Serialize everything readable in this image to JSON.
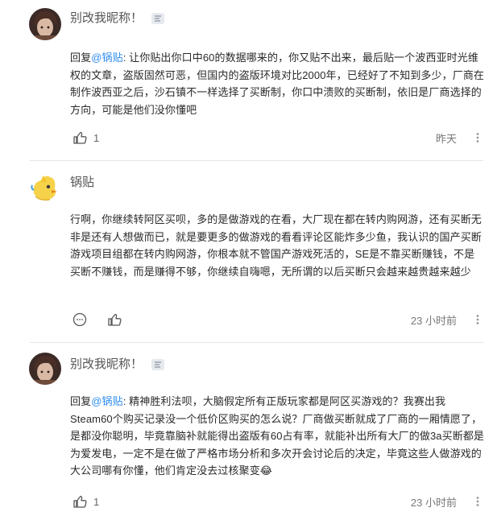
{
  "comments": [
    {
      "username": "别改我昵称！",
      "reply_prefix": "回复",
      "mention": "@锅贴",
      "text": ": 让你贴出你口中60的数据哪来的，你又贴不出来，最后贴一个波西亚时光维权的文章，盗版固然可恶，但国内的盗版环境对比2000年，已经好了不知到多少，厂商在制作波西亚之后，沙石镇不一样选择了买断制，你口中溃败的买断制，依旧是厂商选择的方向，可能是他们没你懂吧",
      "likes": "1",
      "time": "昨天"
    },
    {
      "username": "锅贴",
      "text": "行啊，你继续转阿区买呗，多的是做游戏的在看，大厂现在都在转内购网游，还有买断无非是还有人想做而已，就是要更多的做游戏的看看评论区能炸多少鱼，我认识的国产买断游戏项目组都在转内购网游，你根本就不管国产游戏死活的，SE是不靠买断赚钱，不是买断不赚钱，而是赚得不够，你继续自嗨嗯，无所谓的以后买断只会越来越贵越来越少",
      "time": "23 小时前"
    },
    {
      "username": "别改我昵称！",
      "reply_prefix": "回复",
      "mention": "@锅贴",
      "text": ": 精神胜利法呗，大脑假定所有正版玩家都是阿区买游戏的？我赛出我Steam60个购买记录没一个低价区购买的怎么说？厂商做买断就成了厂商的一厢情愿了，是都没你聪明，毕竟靠脑补就能得出盗版有60占有率，就能补出所有大厂的做3a买断都是为爱发电，一定不是在做了严格市场分析和多次开会讨论后的决定，毕竟这些人做游戏的大公司哪有你懂，他们肯定没去过核聚变😂",
      "likes": "1",
      "time": "23 小时前"
    }
  ],
  "icons": {
    "like": "thumbs-up-icon",
    "comment": "comment-bubble-icon",
    "more": "more-dots-icon",
    "badge": "level-badge-icon"
  },
  "colors": {
    "mention": "#2d8cf0",
    "text": "#2a2a2a",
    "muted": "#777777",
    "divider": "#e5e5e5"
  }
}
